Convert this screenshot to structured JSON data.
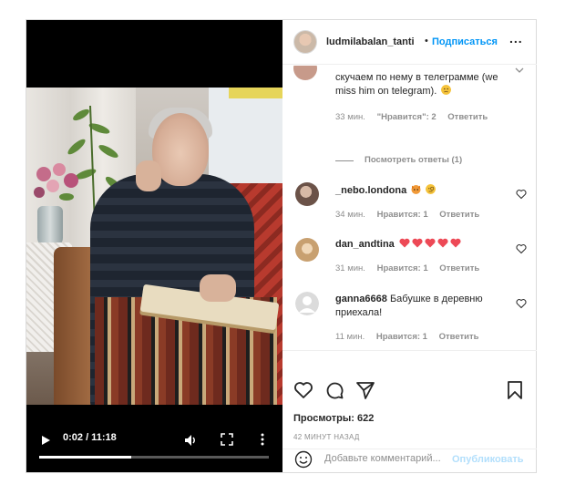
{
  "header": {
    "username": "ludmilabalan_tanti",
    "separator": "•",
    "follow_label": "Подписаться",
    "more_label": "..."
  },
  "comments": [
    {
      "partial_text_line1": "скучаем по нему в телеграмме (we",
      "partial_text_line2": "miss him on telegram).",
      "time": "33 мин.",
      "likes": "\"Нравится\": 2",
      "reply": "Ответить",
      "view_replies": "Посмотреть ответы (1)"
    },
    {
      "username": "_nebo.londona",
      "text": "",
      "time": "34 мин.",
      "likes": "Нравится: 1",
      "reply": "Ответить"
    },
    {
      "username": "dan_andtina",
      "text": "",
      "time": "31 мин.",
      "likes": "Нравится: 1",
      "reply": "Ответить"
    },
    {
      "username": "ganna6668",
      "text_line1": "Бабушке в деревню",
      "text_line2": "приехала!",
      "time": "11 мин.",
      "likes": "Нравится: 1",
      "reply": "Ответить"
    }
  ],
  "video": {
    "time_display": "0:02 / 11:18",
    "progress": 0.4
  },
  "stats": {
    "views": "Просмотры: 622",
    "time_ago": "42 МИНУТ НАЗАД"
  },
  "add_comment": {
    "placeholder": "Добавьте комментарий...",
    "publish_label": "Опубликовать"
  },
  "colors": {
    "accent": "#0095f6",
    "publish_disabled": "#b2dffc",
    "heart_red": "#ed4956"
  }
}
